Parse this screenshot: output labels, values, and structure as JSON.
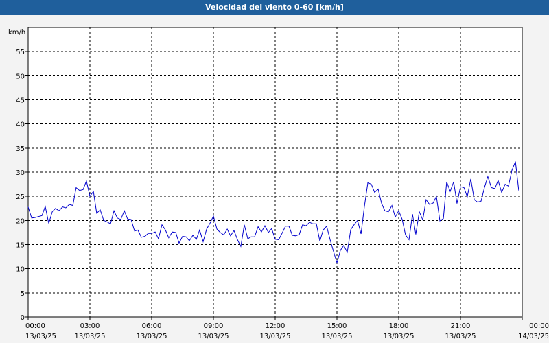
{
  "window": {
    "title": "Velocidad del viento 0-60 [km/h]"
  },
  "colors": {
    "title_bar": "#1f5f9c",
    "title_text": "#ffffff",
    "background": "#f3f3f3",
    "plot_bg": "#ffffff",
    "grid": "#000000",
    "series": "#0000cc"
  },
  "chart_data": {
    "type": "line",
    "title": "Velocidad del viento 0-60 [km/h]",
    "ylabel": "km/h",
    "xlabel": "",
    "ylim": [
      0,
      60
    ],
    "xlim": [
      0,
      24
    ],
    "grid": true,
    "yticks": [
      0,
      5,
      10,
      15,
      20,
      25,
      30,
      35,
      40,
      45,
      50,
      55
    ],
    "xticks": [
      {
        "x": 0,
        "time": "00:00",
        "date": "13/03/25"
      },
      {
        "x": 3,
        "time": "03:00",
        "date": "13/03/25"
      },
      {
        "x": 6,
        "time": "06:00",
        "date": "13/03/25"
      },
      {
        "x": 9,
        "time": "09:00",
        "date": "13/03/25"
      },
      {
        "x": 12,
        "time": "12:00",
        "date": "13/03/25"
      },
      {
        "x": 15,
        "time": "15:00",
        "date": "13/03/25"
      },
      {
        "x": 18,
        "time": "18:00",
        "date": "13/03/25"
      },
      {
        "x": 21,
        "time": "21:00",
        "date": "13/03/25"
      },
      {
        "x": 24,
        "time": "00:00",
        "date": "14/03/25"
      }
    ],
    "series": [
      {
        "points": [
          [
            0.0,
            22.8
          ],
          [
            0.17,
            20.5
          ],
          [
            0.33,
            20.6
          ],
          [
            0.5,
            20.8
          ],
          [
            0.67,
            21.0
          ],
          [
            0.83,
            22.9
          ],
          [
            1.0,
            19.4
          ],
          [
            1.17,
            21.8
          ],
          [
            1.33,
            22.5
          ],
          [
            1.5,
            22.0
          ],
          [
            1.67,
            22.8
          ],
          [
            1.83,
            22.6
          ],
          [
            2.0,
            23.3
          ],
          [
            2.17,
            23.1
          ],
          [
            2.33,
            26.8
          ],
          [
            2.5,
            26.2
          ],
          [
            2.67,
            26.4
          ],
          [
            2.83,
            28.2
          ],
          [
            3.0,
            25.0
          ],
          [
            3.17,
            26.0
          ],
          [
            3.33,
            21.5
          ],
          [
            3.5,
            22.2
          ],
          [
            3.67,
            20.0
          ],
          [
            3.83,
            19.7
          ],
          [
            4.0,
            19.3
          ],
          [
            4.17,
            22.0
          ],
          [
            4.33,
            20.5
          ],
          [
            4.5,
            20.2
          ],
          [
            4.67,
            22.0
          ],
          [
            4.83,
            20.3
          ],
          [
            5.0,
            20.2
          ],
          [
            5.17,
            17.8
          ],
          [
            5.33,
            18.0
          ],
          [
            5.5,
            16.5
          ],
          [
            5.67,
            16.7
          ],
          [
            5.83,
            17.3
          ],
          [
            6.0,
            17.3
          ],
          [
            6.17,
            17.6
          ],
          [
            6.33,
            16.2
          ],
          [
            6.5,
            19.1
          ],
          [
            6.67,
            18.0
          ],
          [
            6.83,
            16.4
          ],
          [
            7.0,
            17.6
          ],
          [
            7.17,
            17.5
          ],
          [
            7.33,
            15.3
          ],
          [
            7.5,
            16.7
          ],
          [
            7.67,
            16.6
          ],
          [
            7.83,
            15.8
          ],
          [
            8.0,
            16.9
          ],
          [
            8.17,
            16.1
          ],
          [
            8.33,
            18.0
          ],
          [
            8.5,
            15.6
          ],
          [
            8.67,
            18.2
          ],
          [
            8.83,
            19.4
          ],
          [
            9.0,
            20.9
          ],
          [
            9.17,
            18.2
          ],
          [
            9.33,
            17.5
          ],
          [
            9.5,
            17.0
          ],
          [
            9.67,
            18.2
          ],
          [
            9.83,
            16.8
          ],
          [
            10.0,
            17.9
          ],
          [
            10.17,
            16.0
          ],
          [
            10.33,
            14.6
          ],
          [
            10.5,
            19.1
          ],
          [
            10.67,
            16.2
          ],
          [
            10.83,
            16.6
          ],
          [
            11.0,
            16.6
          ],
          [
            11.17,
            18.7
          ],
          [
            11.33,
            17.6
          ],
          [
            11.5,
            18.9
          ],
          [
            11.67,
            17.5
          ],
          [
            11.83,
            18.3
          ],
          [
            12.0,
            16.1
          ],
          [
            12.17,
            16.0
          ],
          [
            12.33,
            17.3
          ],
          [
            12.5,
            18.8
          ],
          [
            12.67,
            18.8
          ],
          [
            12.83,
            16.9
          ],
          [
            13.0,
            16.8
          ],
          [
            13.17,
            17.1
          ],
          [
            13.33,
            19.1
          ],
          [
            13.5,
            18.9
          ],
          [
            13.67,
            19.6
          ],
          [
            13.83,
            19.3
          ],
          [
            14.0,
            19.3
          ],
          [
            14.17,
            15.7
          ],
          [
            14.33,
            18.0
          ],
          [
            14.5,
            18.8
          ],
          [
            14.67,
            16.0
          ],
          [
            14.83,
            13.6
          ],
          [
            15.0,
            11.2
          ],
          [
            15.17,
            13.8
          ],
          [
            15.33,
            14.8
          ],
          [
            15.5,
            13.4
          ],
          [
            15.67,
            18.1
          ],
          [
            15.83,
            19.1
          ],
          [
            16.0,
            20.0
          ],
          [
            16.17,
            17.2
          ],
          [
            16.33,
            22.8
          ],
          [
            16.5,
            27.8
          ],
          [
            16.67,
            27.5
          ],
          [
            16.83,
            25.8
          ],
          [
            17.0,
            26.5
          ],
          [
            17.17,
            23.5
          ],
          [
            17.33,
            22.0
          ],
          [
            17.5,
            21.8
          ],
          [
            17.67,
            23.1
          ],
          [
            17.83,
            20.7
          ],
          [
            18.0,
            22.0
          ],
          [
            18.17,
            20.2
          ],
          [
            18.33,
            17.0
          ],
          [
            18.5,
            16.0
          ],
          [
            18.67,
            21.3
          ],
          [
            18.83,
            17.1
          ],
          [
            19.0,
            21.8
          ],
          [
            19.17,
            20.1
          ],
          [
            19.33,
            24.3
          ],
          [
            19.5,
            23.3
          ],
          [
            19.67,
            23.6
          ],
          [
            19.83,
            25.0
          ],
          [
            20.0,
            19.9
          ],
          [
            20.17,
            20.4
          ],
          [
            20.33,
            28.0
          ],
          [
            20.5,
            26.0
          ],
          [
            20.67,
            28.0
          ],
          [
            20.83,
            23.5
          ],
          [
            21.0,
            27.0
          ],
          [
            21.17,
            26.8
          ],
          [
            21.33,
            24.9
          ],
          [
            21.5,
            28.6
          ],
          [
            21.67,
            24.3
          ],
          [
            21.83,
            23.8
          ],
          [
            22.0,
            24.0
          ],
          [
            22.17,
            26.9
          ],
          [
            22.33,
            29.1
          ],
          [
            22.5,
            26.8
          ],
          [
            22.67,
            26.6
          ],
          [
            22.83,
            28.3
          ],
          [
            23.0,
            25.8
          ],
          [
            23.17,
            27.5
          ],
          [
            23.33,
            27.1
          ],
          [
            23.5,
            30.4
          ],
          [
            23.67,
            32.2
          ],
          [
            23.83,
            26.2
          ]
        ]
      }
    ]
  }
}
